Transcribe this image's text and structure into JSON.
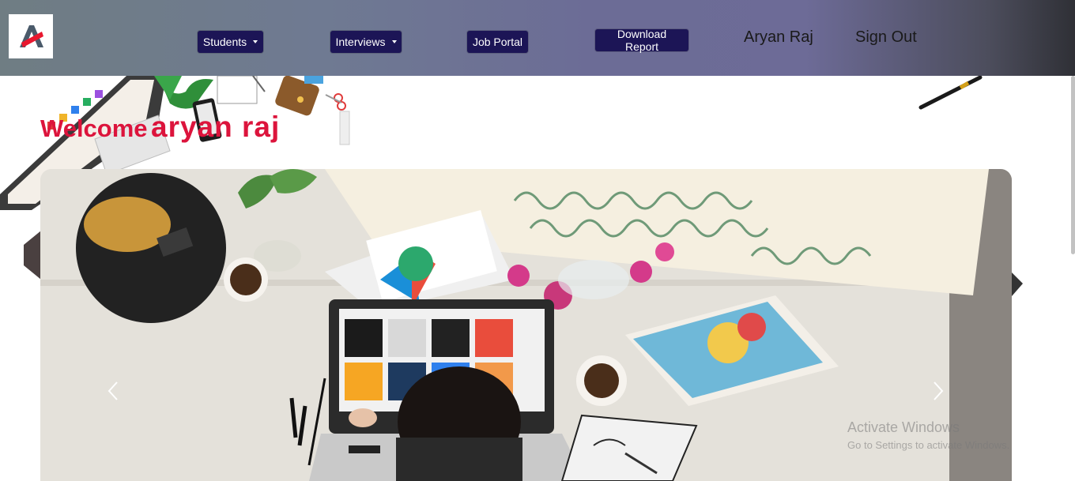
{
  "navbar": {
    "logo_alt": "A",
    "items": [
      {
        "label": "Students",
        "dropdown": true
      },
      {
        "label": "Interviews",
        "dropdown": true
      },
      {
        "label": "Job Portal",
        "dropdown": false
      },
      {
        "label": "Download Report",
        "dropdown": false
      }
    ],
    "user_name": "Aryan Raj",
    "sign_out": "Sign Out"
  },
  "welcome": {
    "greeting": "Welcome",
    "name": "aryan raj"
  },
  "carousel": {
    "prev_icon": "chevron-left-icon",
    "next_icon": "chevron-right-icon"
  },
  "watermark": {
    "title": "Activate Windows",
    "subtitle": "Go to Settings to activate Windows."
  },
  "colors": {
    "nav_button_bg": "#1c1556",
    "welcome_text": "#dc143c"
  }
}
